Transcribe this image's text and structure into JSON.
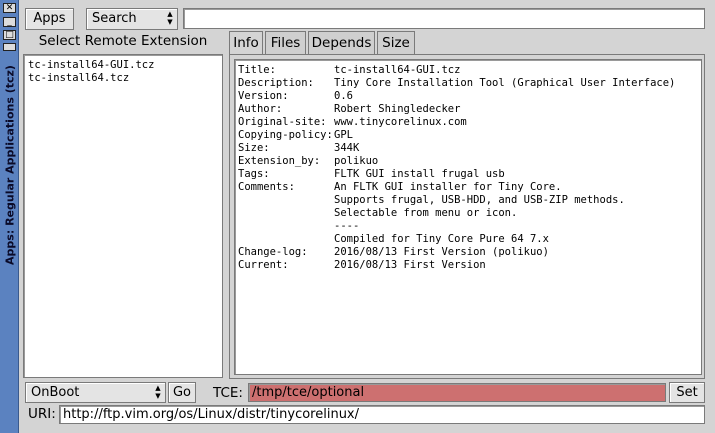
{
  "window": {
    "title": "Apps: Regular Applications (tcz)",
    "icons": [
      "close-icon",
      "minimize-icon",
      "maximize-icon",
      "shade-icon",
      "menu-icon"
    ]
  },
  "toolbar": {
    "apps_label": "Apps",
    "search_mode": "Search",
    "search_value": ""
  },
  "extensions": {
    "heading": "Select Remote Extension",
    "items": [
      "tc-install64-GUI.tcz",
      "tc-install64.tcz"
    ]
  },
  "tabs": [
    {
      "label": "Info",
      "active": true
    },
    {
      "label": "Files",
      "active": false
    },
    {
      "label": "Depends",
      "active": false
    },
    {
      "label": "Size",
      "active": false
    }
  ],
  "info": [
    {
      "key": "Title:",
      "value": "tc-install64-GUI.tcz"
    },
    {
      "key": "Description:",
      "value": "Tiny Core Installation Tool (Graphical User Interface)"
    },
    {
      "key": "Version:",
      "value": "0.6"
    },
    {
      "key": "Author:",
      "value": "Robert Shingledecker"
    },
    {
      "key": "Original-site:",
      "value": "www.tinycorelinux.com"
    },
    {
      "key": "Copying-policy:",
      "value": "GPL"
    },
    {
      "key": "Size:",
      "value": "344K"
    },
    {
      "key": "Extension_by:",
      "value": "polikuo"
    },
    {
      "key": "Tags:",
      "value": "FLTK GUI install frugal usb"
    },
    {
      "key": "Comments:",
      "value": "An FLTK GUI installer for Tiny Core."
    },
    {
      "key": "",
      "value": "Supports frugal, USB-HDD, and USB-ZIP methods."
    },
    {
      "key": "",
      "value": "Selectable from menu or icon."
    },
    {
      "key": "",
      "value": "----"
    },
    {
      "key": "",
      "value": "Compiled for Tiny Core Pure 64 7.x"
    },
    {
      "key": "Change-log:",
      "value": "2016/08/13 First Version (polikuo)"
    },
    {
      "key": "Current:",
      "value": "2016/08/13 First Version"
    }
  ],
  "bottom": {
    "load_mode": "OnBoot",
    "go_label": "Go",
    "tce_label": "TCE:",
    "tce_value": "/tmp/tce/optional",
    "set_label": "Set",
    "uri_label": "URI:",
    "uri_value": "http://ftp.vim.org/os/Linux/distr/tinycorelinux/"
  },
  "colors": {
    "title_strip": "#5b82c0",
    "tce_field": "#cd7070"
  }
}
